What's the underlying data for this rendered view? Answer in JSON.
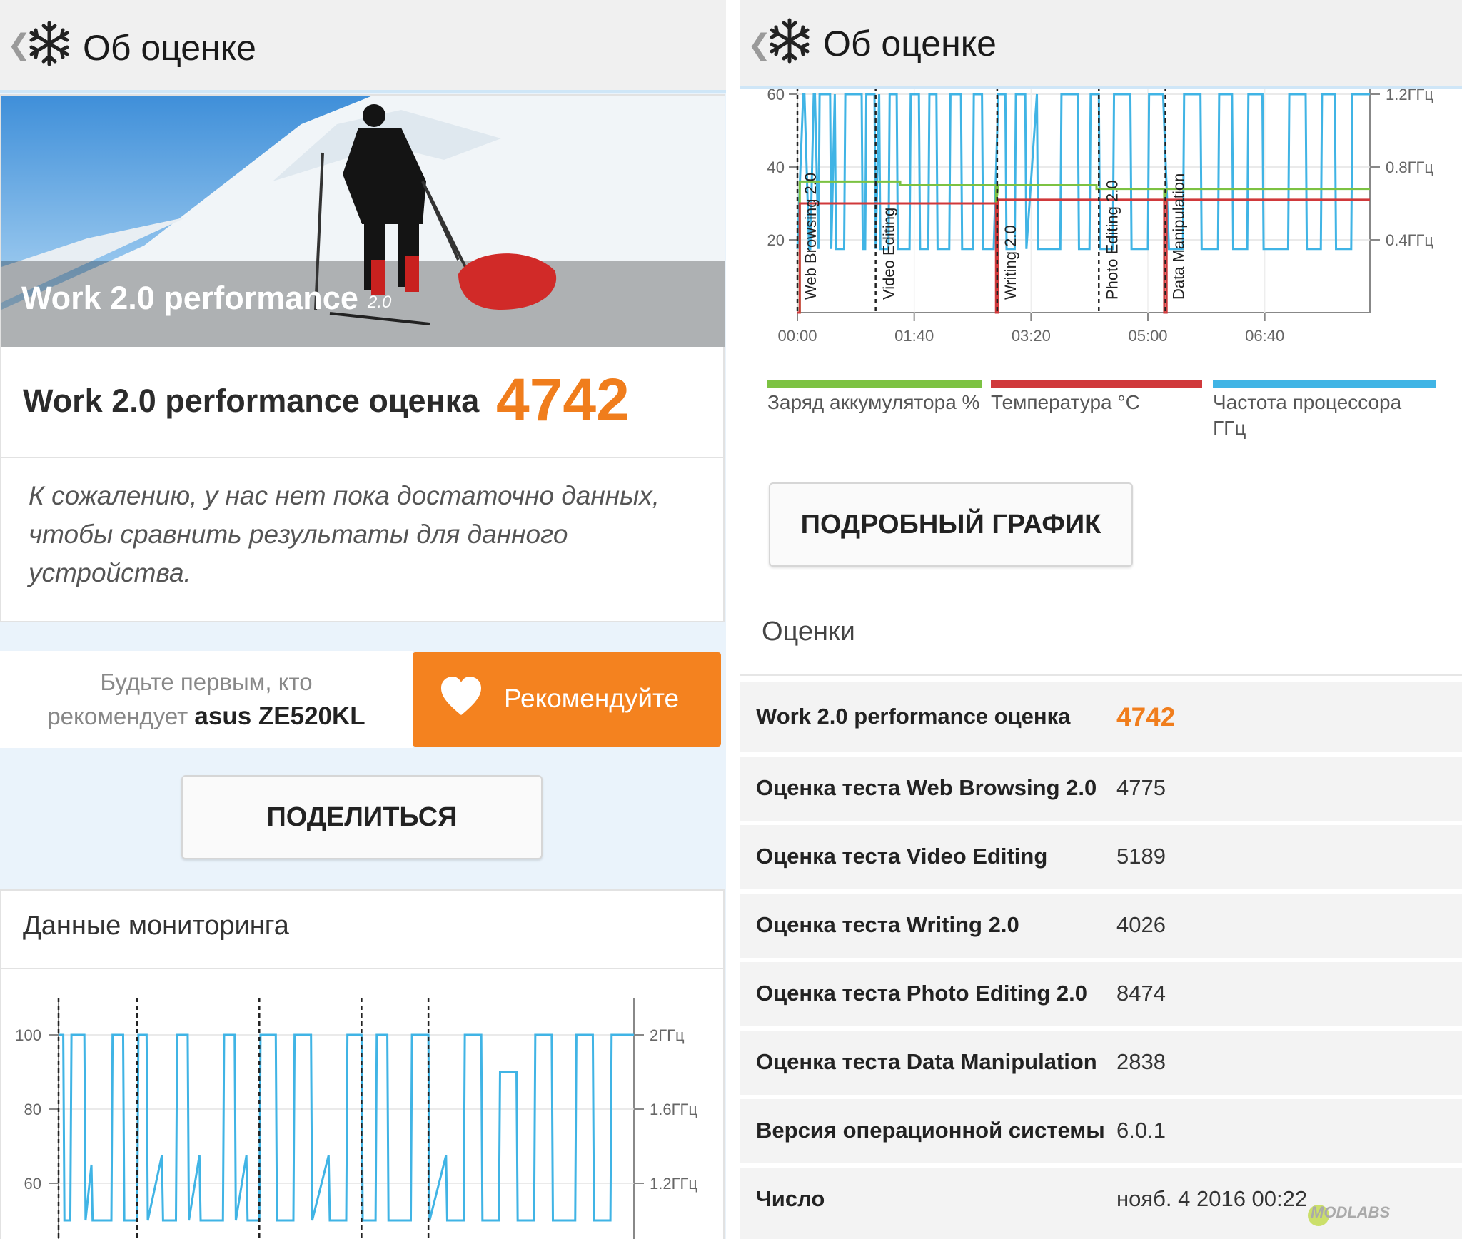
{
  "header": {
    "back_glyph": "❮",
    "title": "Об оценке",
    "icon": "snowflake-icon"
  },
  "left": {
    "hero": {
      "title": "Work 2.0 performance",
      "version": "2.0"
    },
    "score": {
      "label": "Work 2.0 performance оценка",
      "value": "4742"
    },
    "message": "К сожалению, у нас нет пока достаточно данных, чтобы сравнить результаты для данного устройства.",
    "recommend": {
      "line1": "Будьте первым, кто",
      "line2_prefix": "рекомендует ",
      "device": "asus ZE520KL",
      "button": "Рекомендуйте",
      "icon": "heart-icon"
    },
    "share_button": "ПОДЕЛИТЬСЯ",
    "monitoring_title": "Данные мониторинга"
  },
  "right": {
    "detail_button": "ПОДРОБНЫЙ ГРАФИК",
    "scores_title": "Оценки",
    "scores": [
      {
        "label": "Work 2.0 performance оценка",
        "value": "4742"
      },
      {
        "label": "Оценка теста Web Browsing 2.0",
        "value": "4775"
      },
      {
        "label": "Оценка теста Video Editing",
        "value": "5189"
      },
      {
        "label": "Оценка теста Writing 2.0",
        "value": "4026"
      },
      {
        "label": "Оценка теста Photo Editing 2.0",
        "value": "8474"
      },
      {
        "label": "Оценка теста Data Manipulation",
        "value": "2838"
      },
      {
        "label": "Версия операционной системы",
        "value": "6.0.1"
      },
      {
        "label": "Число",
        "value": "нояб. 4 2016 00:22"
      }
    ],
    "legend": [
      {
        "label": "Заряд аккумулятора %",
        "color": "#7cc242"
      },
      {
        "label": "Температура °C",
        "color": "#d0393b"
      },
      {
        "label": "Частота процессора ГГц",
        "color": "#40b4e5"
      }
    ]
  },
  "watermark": "MODLABS",
  "colors": {
    "accent": "#f07d1c",
    "cpu": "#40b4e5",
    "battery": "#7cc242",
    "temp": "#d0393b"
  },
  "chart_data": [
    {
      "type": "line",
      "title": "",
      "y_left_ticks": [
        "20",
        "40",
        "60"
      ],
      "y_right_ticks": [
        "0.4ГГц",
        "0.8ГГц",
        "1.2ГГц"
      ],
      "x_ticks": [
        "00:00",
        "01:40",
        "03:20",
        "05:00",
        "06:40"
      ],
      "xlim_seconds": [
        0,
        490
      ],
      "ylim_left": [
        0,
        60
      ],
      "ylim_right_ghz": [
        0,
        1.2
      ],
      "test_markers": [
        {
          "label": "Web Browsing 2.0",
          "t": 0
        },
        {
          "label": "Video Editing",
          "t": 67
        },
        {
          "label": "Writing 2.0",
          "t": 171
        },
        {
          "label": "Photo Editing 2.0",
          "t": 258
        },
        {
          "label": "Data Manipulation",
          "t": 315
        }
      ],
      "series": [
        {
          "name": "Заряд аккумулятора %",
          "x": [
            0,
            2,
            2,
            88,
            88,
            170,
            170,
            172,
            256,
            256,
            314,
            314,
            316,
            490
          ],
          "values": [
            0,
            0,
            36,
            36,
            35,
            35,
            30,
            35,
            35,
            34,
            34,
            30,
            34,
            34
          ]
        },
        {
          "name": "Температура °C",
          "x": [
            0,
            2,
            2,
            170,
            170,
            172,
            172,
            314,
            314,
            316,
            316,
            490
          ],
          "values": [
            0,
            0,
            30,
            30,
            0,
            0,
            31,
            31,
            0,
            0,
            31,
            31
          ]
        },
        {
          "name": "Частота процессора ГГц",
          "x": [
            0,
            5,
            6,
            10,
            11,
            14,
            15,
            18,
            19,
            28,
            29,
            32,
            33,
            40,
            41,
            55,
            56,
            58,
            59,
            66,
            67,
            70,
            71,
            78,
            79,
            85,
            86,
            96,
            97,
            104,
            105,
            112,
            113,
            119,
            120,
            130,
            131,
            140,
            141,
            150,
            151,
            158,
            159,
            168,
            172,
            178,
            179,
            186,
            187,
            195,
            196,
            205,
            206,
            216,
            217,
            225,
            226,
            240,
            241,
            250,
            251,
            258,
            259,
            270,
            271,
            285,
            286,
            300,
            301,
            313,
            318,
            330,
            331,
            345,
            346,
            360,
            361,
            372,
            373,
            385,
            386,
            398,
            399,
            420,
            421,
            435,
            436,
            448,
            449,
            460,
            461,
            474,
            475,
            490
          ],
          "values": [
            0.35,
            1.2,
            1.2,
            0.35,
            0.35,
            1.2,
            1.2,
            0.35,
            1.2,
            1.2,
            0.35,
            1.2,
            0.35,
            0.35,
            1.2,
            1.2,
            0.35,
            0.35,
            1.2,
            1.2,
            0.35,
            1.2,
            0.35,
            0.35,
            1.2,
            1.2,
            0.35,
            0.35,
            1.2,
            1.2,
            0.35,
            0.35,
            1.2,
            1.2,
            0.35,
            0.35,
            1.2,
            1.2,
            0.35,
            0.35,
            1.2,
            1.2,
            0.35,
            0.35,
            1.2,
            1.2,
            0.35,
            0.35,
            1.2,
            1.2,
            0.35,
            1.2,
            0.35,
            0.35,
            0.35,
            0.35,
            1.2,
            1.2,
            0.35,
            0.35,
            1.2,
            1.2,
            0.35,
            0.35,
            1.2,
            1.2,
            0.35,
            0.35,
            1.2,
            1.2,
            0.35,
            0.35,
            1.2,
            1.2,
            0.35,
            0.35,
            1.2,
            1.2,
            0.35,
            0.35,
            1.2,
            1.2,
            0.35,
            0.35,
            1.2,
            1.2,
            0.35,
            0.35,
            1.2,
            1.2,
            0.35,
            0.35,
            1.2,
            1.2
          ]
        }
      ]
    },
    {
      "type": "line",
      "title": "",
      "y_left_ticks": [
        "60",
        "80",
        "100"
      ],
      "y_right_ticks": [
        "1.2ГГц",
        "1.6ГГц",
        "2ГГц"
      ],
      "ylim_left_visible": [
        55,
        100
      ],
      "ylim_right_ghz_visible": [
        1.1,
        2.0
      ],
      "xlim_seconds": [
        0,
        490
      ],
      "test_markers": [
        0,
        67,
        171,
        258,
        315
      ],
      "series": [
        {
          "name": "Частота процессора ГГц",
          "x": [
            0,
            4,
            5,
            10,
            11,
            22,
            23,
            28,
            29,
            45,
            46,
            55,
            56,
            67,
            68,
            75,
            76,
            88,
            89,
            100,
            101,
            110,
            111,
            120,
            121,
            140,
            141,
            150,
            151,
            160,
            161,
            171,
            172,
            185,
            186,
            200,
            201,
            215,
            216,
            230,
            231,
            245,
            246,
            258,
            259,
            270,
            271,
            280,
            281,
            300,
            301,
            315,
            316,
            330,
            331,
            345,
            346,
            360,
            361,
            375,
            376,
            390,
            391,
            405,
            406,
            420,
            421,
            440,
            441,
            455,
            456,
            470,
            471,
            490
          ],
          "values": [
            2.0,
            2.0,
            1.0,
            1.0,
            2.0,
            2.0,
            1.0,
            1.3,
            1.0,
            1.0,
            2.0,
            2.0,
            1.0,
            1.0,
            2.0,
            2.0,
            1.0,
            1.35,
            1.0,
            1.0,
            2.0,
            2.0,
            1.0,
            1.35,
            1.0,
            1.0,
            2.0,
            2.0,
            1.0,
            1.35,
            1.0,
            1.0,
            2.0,
            2.0,
            1.0,
            1.0,
            2.0,
            2.0,
            1.0,
            1.35,
            1.0,
            1.0,
            2.0,
            2.0,
            1.0,
            1.0,
            2.0,
            2.0,
            1.0,
            1.0,
            2.0,
            2.0,
            1.0,
            1.35,
            1.0,
            1.0,
            2.0,
            2.0,
            1.0,
            1.0,
            1.8,
            1.8,
            1.0,
            1.0,
            2.0,
            2.0,
            1.0,
            1.0,
            2.0,
            2.0,
            1.0,
            1.0,
            2.0,
            2.0
          ]
        }
      ]
    }
  ]
}
